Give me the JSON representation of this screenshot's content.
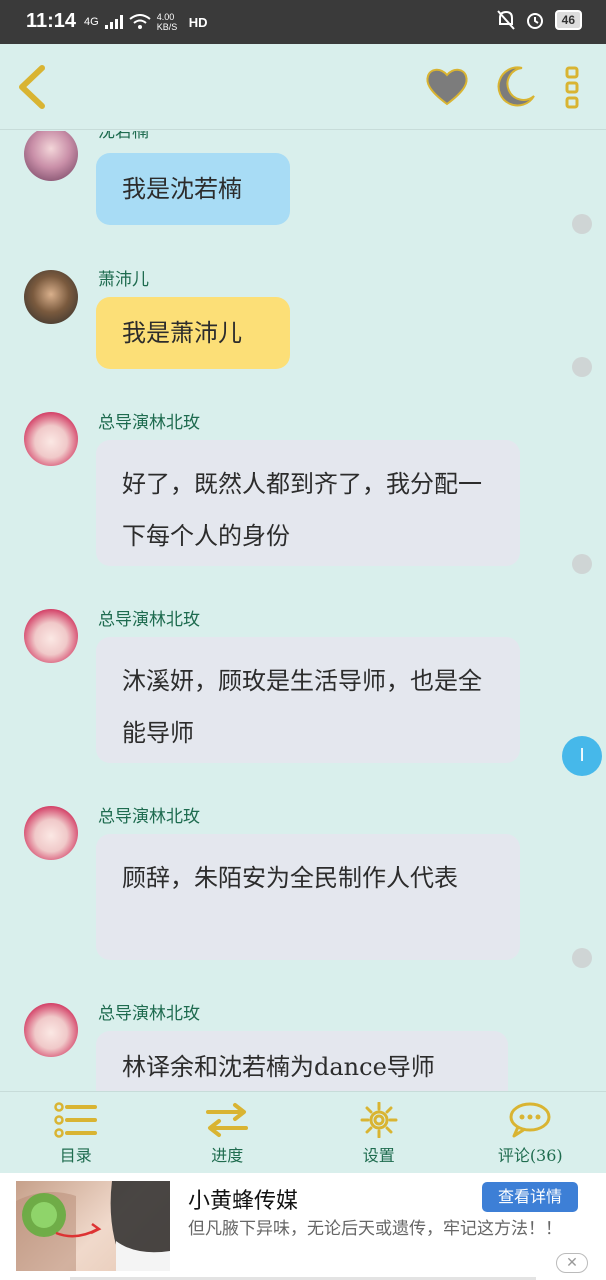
{
  "status_bar": {
    "time": "11:14",
    "network": "4G",
    "speed": "4.00 KB/S",
    "hd": "HD",
    "battery": "46"
  },
  "header": {
    "icons": [
      "back-icon",
      "heart-icon",
      "moon-icon",
      "more-icon"
    ]
  },
  "messages": [
    {
      "sender": "沈若楠",
      "text": "我是沈若楠",
      "style": "blue"
    },
    {
      "sender": "萧沛儿",
      "text": "我是萧沛儿",
      "style": "yellow"
    },
    {
      "sender": "总导演林北玫",
      "text": "好了，既然人都到齐了，我分配一下每个人的身份",
      "style": "grey"
    },
    {
      "sender": "总导演林北玫",
      "text": "沐溪妍，顾玫是生活导师，也是全能导师",
      "style": "grey"
    },
    {
      "sender": "总导演林北玫",
      "text": "顾辞，朱陌安为全民制作人代表",
      "style": "grey"
    },
    {
      "sender": "总导演林北玫",
      "text": "林译余和沈若楠为dance导师",
      "style": "grey"
    }
  ],
  "comment_pin": "I",
  "bottom_nav": [
    {
      "label": "目录",
      "icon": "list-icon"
    },
    {
      "label": "进度",
      "icon": "progress-arrows-icon"
    },
    {
      "label": "设置",
      "icon": "gear-icon"
    },
    {
      "label": "评论(36)",
      "icon": "comment-icon"
    }
  ],
  "ad": {
    "title": "小黄蜂传媒",
    "button": "查看详情",
    "desc": "但凡腋下异味，无论后天或遗传，牢记这方法！！",
    "close": "✕"
  },
  "colors": {
    "background": "#d9efec",
    "bubble_blue": "#a8dcf5",
    "bubble_yellow": "#fcdf77",
    "bubble_grey": "#e4e7ee",
    "sender_green": "#1e6b4f",
    "accent_blue": "#46b8ea"
  }
}
